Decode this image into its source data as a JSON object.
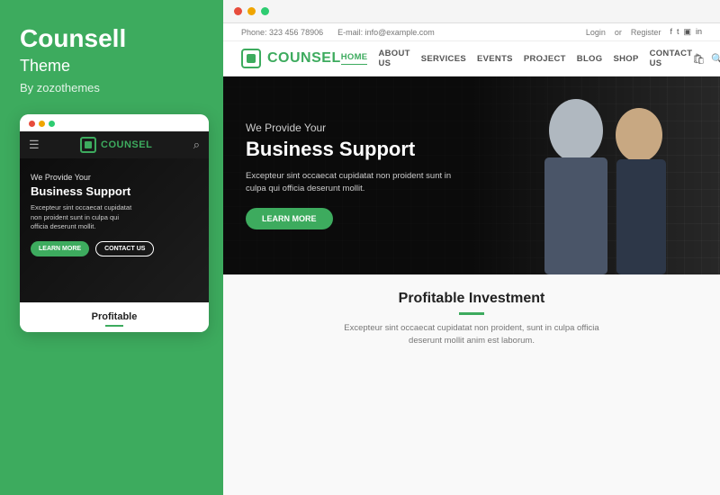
{
  "left": {
    "title": "Counsell",
    "subtitle": "Theme",
    "author": "By zozothemes",
    "mobile": {
      "dots": [
        "#e74c3c",
        "#f0a500",
        "#2ecc71"
      ],
      "logo_text_main": "COUN",
      "logo_text_accent": "SEL",
      "hero_subtitle": "We Provide Your",
      "hero_title": "Business Support",
      "hero_desc": "Excepteur sint occaecat cupidatat\nnon proident sunt in culpa qui\nofficia deserunt mollit.",
      "btn_learn": "LEARN MORE",
      "btn_contact": "CONTACT US",
      "bottom_title": "Profitable"
    }
  },
  "right": {
    "browser_dots": [
      "#e74c3c",
      "#f0a500",
      "#2ecc71"
    ],
    "topbar": {
      "phone": "Phone: 323 456 78906",
      "email": "E-mail: info@example.com",
      "login": "Login",
      "or": "or",
      "register": "Register",
      "social": [
        "f",
        "t",
        "in",
        "in"
      ]
    },
    "navbar": {
      "logo_main": "COUN",
      "logo_accent": "SEL",
      "nav_items": [
        {
          "label": "HOME",
          "active": true
        },
        {
          "label": "ABOUT US",
          "active": false
        },
        {
          "label": "SERVICES",
          "active": false
        },
        {
          "label": "EVENTS",
          "active": false
        },
        {
          "label": "PROJECT",
          "active": false
        },
        {
          "label": "BLOG",
          "active": false
        },
        {
          "label": "SHOP",
          "active": false
        },
        {
          "label": "CONTACT US",
          "active": false
        }
      ]
    },
    "hero": {
      "pre_title": "We Provide Your",
      "title": "Business Support",
      "desc": "Excepteur sint occaecat cupidatat non proident sunt in\nculpa qui officia deserunt mollit.",
      "btn_label": "LEARN MORE"
    },
    "bottom": {
      "heading": "Profitable Investment",
      "desc": "Excepteur sint occaecat cupidatat non proident, sunt in culpa officia\ndeserunt mollit anim est laborum."
    }
  },
  "colors": {
    "green": "#3dab5e",
    "dark": "#1a1a1a",
    "text_dark": "#222",
    "text_mid": "#555",
    "text_light": "#777"
  }
}
